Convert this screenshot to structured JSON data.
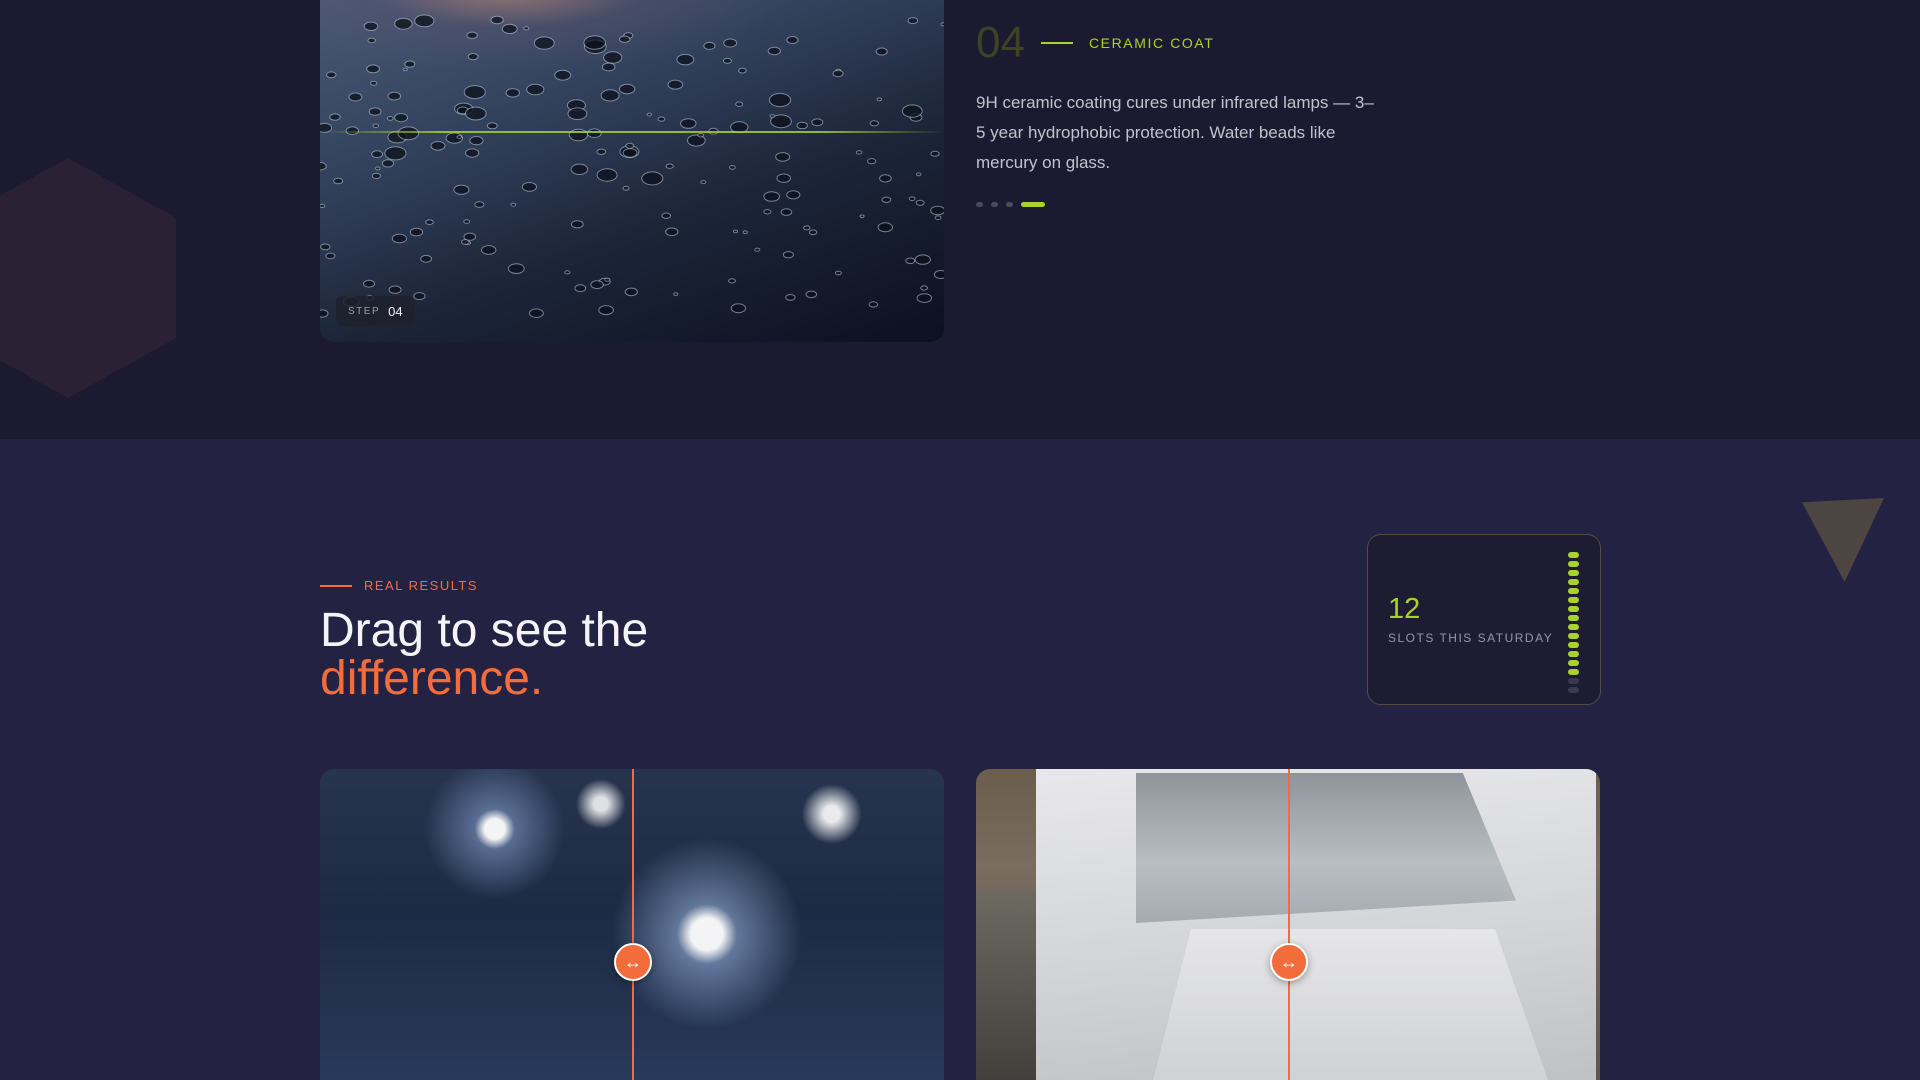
{
  "process_step": {
    "number": "04",
    "title": "CERAMIC COAT",
    "description": "9H ceramic coating cures under infrared lamps — 3–5 year hydrophobic protection. Water beads like mercury on glass.",
    "badge_label": "STEP",
    "badge_number": "04",
    "step_indicator": {
      "total": 4,
      "active": 4
    }
  },
  "results": {
    "eyebrow": "REAL RESULTS",
    "headline_line1": "Drag to see the",
    "headline_accent": "difference.",
    "slots": {
      "count": "12",
      "label": "SLOTS THIS SATURDAY",
      "meter_total": 16,
      "meter_filled": 14
    },
    "comparisons": [
      {
        "subject": "paint-swirls",
        "handle_glyph": "↔"
      },
      {
        "subject": "white-suv",
        "handle_glyph": "↔"
      }
    ]
  },
  "colors": {
    "background_top": "#1c1a30",
    "background_bottom": "#242242",
    "accent_green": "#a9d22e",
    "accent_orange": "#f26d3b"
  }
}
